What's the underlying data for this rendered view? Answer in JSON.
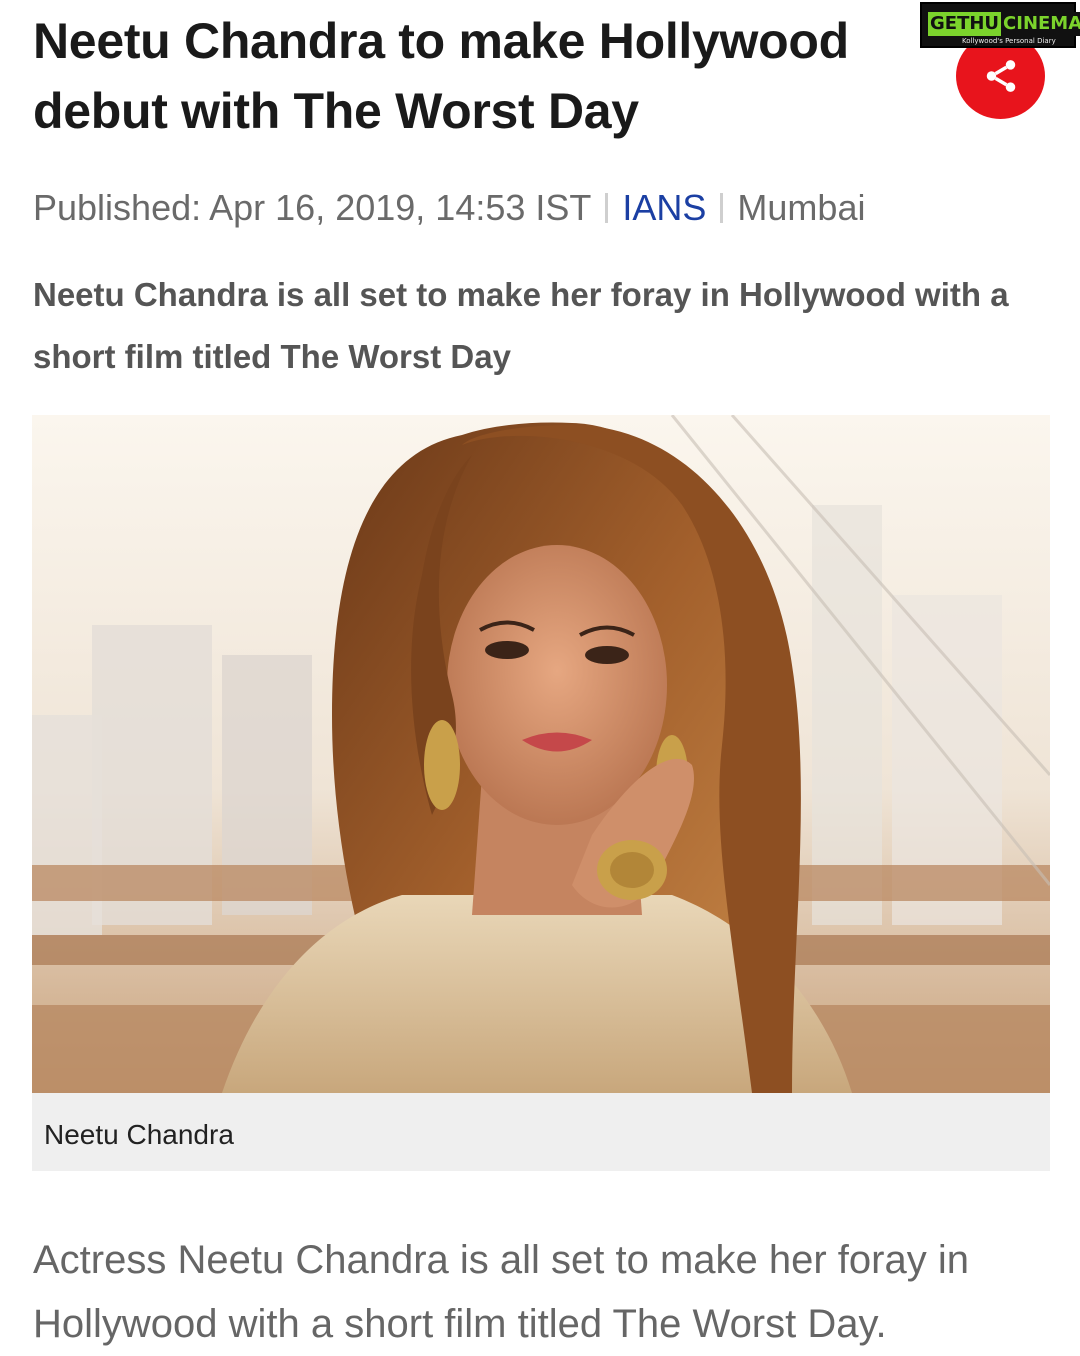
{
  "article": {
    "headline": "Neetu Chandra to make Hollywood debut with The Worst Day",
    "meta": {
      "published": "Published: Apr 16, 2019, 14:53 IST",
      "agency": "IANS",
      "location": "Mumbai"
    },
    "summary": "Neetu Chandra is all set to make her foray in Hollywood with a short film titled The Worst Day",
    "image": {
      "caption": "Neetu Chandra"
    },
    "body": "Actress Neetu Chandra is all set to make her foray in Hollywood with a short film titled The Worst Day."
  },
  "share_button": {
    "icon": "share-icon",
    "color": "#e8141c"
  },
  "watermark": {
    "brand_part1": "GETHU",
    "brand_part2": "CINEMA",
    "tagline": "Kollywood's Personal Diary"
  },
  "colors": {
    "headline": "#1a1a1a",
    "agency_link": "#1b3fa3",
    "meta_text": "#6a6a6a",
    "caption_bg": "#efefef"
  }
}
